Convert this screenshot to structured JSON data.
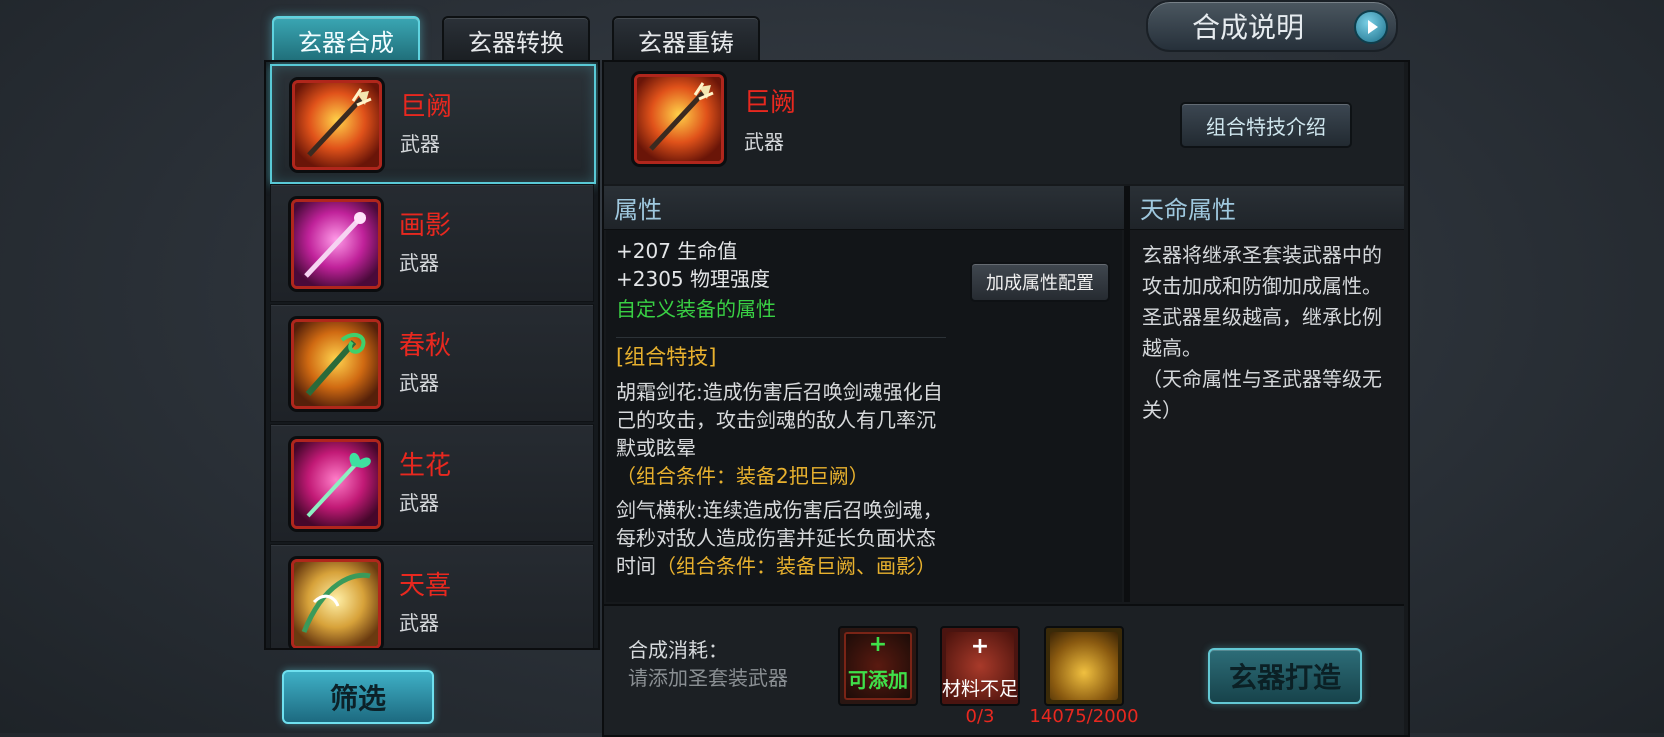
{
  "tabs": [
    {
      "label": "玄器合成",
      "active": true
    },
    {
      "label": "玄器转换",
      "active": false
    },
    {
      "label": "玄器重铸",
      "active": false
    }
  ],
  "help_button": {
    "label": "合成说明",
    "icon": "play-arrow-icon"
  },
  "weapon_list": [
    {
      "name": "巨阙",
      "type": "武器",
      "icon": "flame-spear-icon",
      "selected": true
    },
    {
      "name": "画影",
      "type": "武器",
      "icon": "magenta-sword-icon",
      "selected": false
    },
    {
      "name": "春秋",
      "type": "武器",
      "icon": "dragon-blade-icon",
      "selected": false
    },
    {
      "name": "生花",
      "type": "武器",
      "icon": "flower-staff-icon",
      "selected": false
    },
    {
      "name": "天喜",
      "type": "武器",
      "icon": "jade-bow-icon",
      "selected": false
    }
  ],
  "filter_button": {
    "label": "筛选"
  },
  "detail": {
    "name": "巨阙",
    "type": "武器",
    "icon": "flame-spear-icon",
    "combo_button": "组合特技介绍"
  },
  "attributes": {
    "header": "属性",
    "stats": [
      "+207 生命值",
      "+2305 物理强度"
    ],
    "custom_note": "自定义装备的属性",
    "config_button": "加成属性配置",
    "skills_title": "[组合特技]",
    "skill1_text": "胡霜剑花:造成伤害后召唤剑魂强化自己的攻击，攻击剑魂的敌人有几率沉默或眩晕",
    "skill1_cond": "（组合条件：装备2把巨阙）",
    "skill2_text": "剑气横秋:连续造成伤害后召唤剑魂，每秒对敌人造成伤害并延长负面状态时间",
    "skill2_cond": "（组合条件：装备巨阙、画影）"
  },
  "fate": {
    "header": "天命属性",
    "text": "玄器将继承圣套装武器中的攻击加成和防御加成属性。圣武器星级越高，继承比例越高。",
    "note": "（天命属性与圣武器等级无关）"
  },
  "cost": {
    "label": "合成消耗：",
    "hint": "请添加圣套装武器",
    "slot_add": "可添加",
    "slot_material": "材料不足",
    "material_count": "0/3",
    "gold_count": "14075/2000",
    "plus": "+"
  },
  "forge_button": {
    "label": "玄器打造"
  },
  "colors": {
    "accent": "#59c9d6",
    "item_name": "#e8281f",
    "green": "#39d044",
    "gold": "#e8b12e",
    "insufficient": "#e8281f"
  }
}
